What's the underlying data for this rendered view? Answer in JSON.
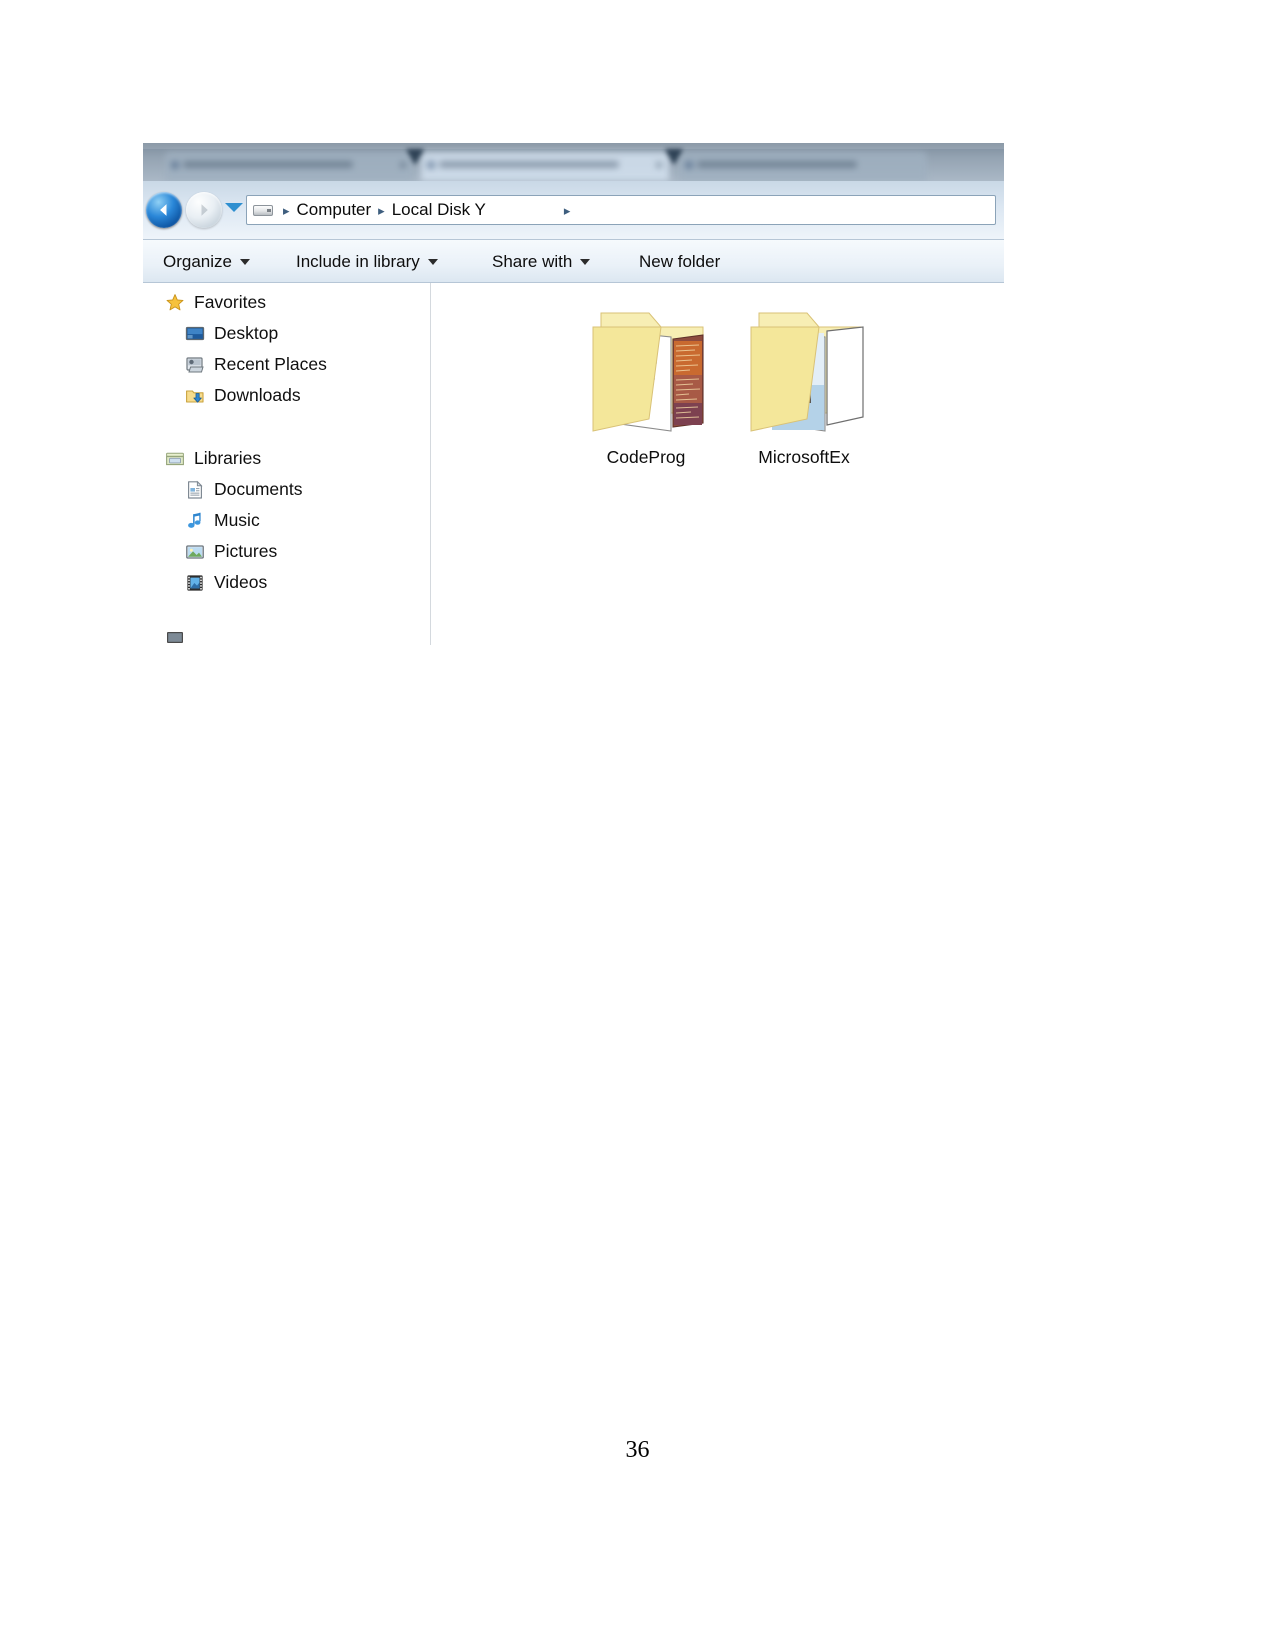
{
  "document": {
    "page_number": "36"
  },
  "explorer": {
    "navigation": {
      "back_icon": "back-arrow-icon",
      "forward_icon": "forward-arrow-icon",
      "history_icon": "chevron-down-icon"
    },
    "address_bar": {
      "drive_icon": "hard-drive-icon",
      "separator": "▸",
      "crumbs": [
        {
          "label": "Computer"
        },
        {
          "label": "Local Disk Y"
        }
      ]
    },
    "toolbar": {
      "organize": "Organize",
      "include_in_library": "Include in library",
      "share_with": "Share with",
      "new_folder": "New folder",
      "caret_icon": "caret-down-icon"
    },
    "sidebar": {
      "groups": [
        {
          "header": {
            "label": "Favorites",
            "icon": "star-icon"
          },
          "items": [
            {
              "label": "Desktop",
              "icon": "desktop-icon"
            },
            {
              "label": "Recent Places",
              "icon": "recent-places-icon"
            },
            {
              "label": "Downloads",
              "icon": "downloads-folder-icon"
            }
          ]
        },
        {
          "header": {
            "label": "Libraries",
            "icon": "libraries-icon"
          },
          "items": [
            {
              "label": "Documents",
              "icon": "documents-icon"
            },
            {
              "label": "Music",
              "icon": "music-note-icon"
            },
            {
              "label": "Pictures",
              "icon": "pictures-icon"
            },
            {
              "label": "Videos",
              "icon": "videos-filmstrip-icon"
            }
          ]
        }
      ]
    },
    "content": {
      "items": [
        {
          "label": "CodeProg",
          "icon": "folder-icon",
          "thumbnail": "code-document-thumbnail"
        },
        {
          "label": "MicrosoftEx",
          "icon": "folder-icon",
          "thumbnail": "photo-document-thumbnail"
        }
      ]
    },
    "colors": {
      "folder_yellow": "#f6e9a8",
      "accent_blue": "#2a87d8",
      "toolbar_bg": "#eaf1f8",
      "chrome_blue": "#c9d8e6"
    }
  }
}
